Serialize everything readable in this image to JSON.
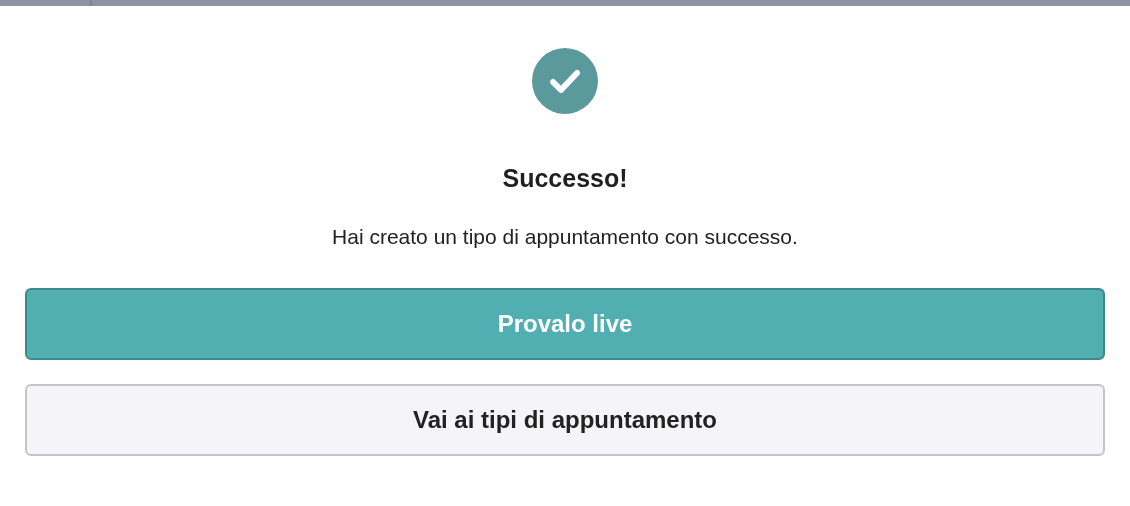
{
  "dialog": {
    "title": "Successo!",
    "message": "Hai creato un tipo di appuntamento con successo."
  },
  "buttons": [
    {
      "label": "Provalo live",
      "kind": "primary"
    },
    {
      "label": "Vai ai tipi di appuntamento",
      "kind": "secondary"
    }
  ]
}
